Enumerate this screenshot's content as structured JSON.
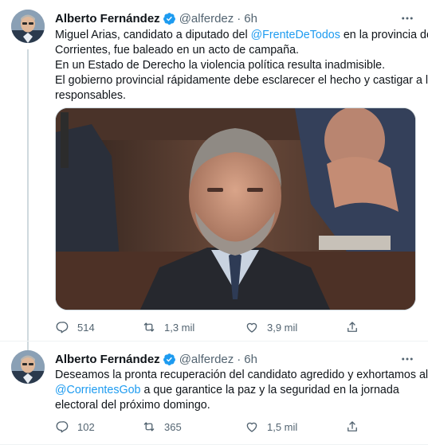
{
  "tweets": [
    {
      "author_name": "Alberto Fernández",
      "handle": "@alferdez",
      "separator": "·",
      "time": "6h",
      "text_lines": [
        {
          "before": "Miguel Arias, candidato a diputado del ",
          "mention": "@FrenteDeTodos",
          "after": " en la provincia de"
        },
        {
          "before": "Corrientes, fue baleado en un acto de campaña.",
          "mention": "",
          "after": ""
        },
        {
          "before": "En un Estado de Derecho la violencia política resulta inadmisible.",
          "mention": "",
          "after": ""
        },
        {
          "before": "El gobierno provincial rápidamente debe esclarecer el hecho y castigar a los",
          "mention": "",
          "after": ""
        },
        {
          "before": "responsables.",
          "mention": "",
          "after": ""
        }
      ],
      "replies": "514",
      "retweets": "1,3 mil",
      "likes": "3,9 mil"
    },
    {
      "author_name": "Alberto Fernández",
      "handle": "@alferdez",
      "separator": "·",
      "time": "6h",
      "text_lines": [
        {
          "before": "Deseamos la pronta recuperación del candidato agredido y exhortamos al",
          "mention": "",
          "after": ""
        },
        {
          "before": "",
          "mention": "@CorrientesGob",
          "after": " a que garantice la paz y la seguridad en la jornada"
        },
        {
          "before": "electoral del próximo domingo.",
          "mention": "",
          "after": ""
        }
      ],
      "replies": "102",
      "retweets": "365",
      "likes": "1,5 mil"
    }
  ],
  "icons": {
    "verified": "verified-badge-icon",
    "more": "more-options-icon",
    "reply": "reply-icon",
    "retweet": "retweet-icon",
    "like": "like-icon",
    "share": "share-icon"
  },
  "colors": {
    "accent": "#1d9bf0",
    "text": "#0f1419",
    "secondary": "#536471",
    "thread_line": "#cfd9de"
  }
}
